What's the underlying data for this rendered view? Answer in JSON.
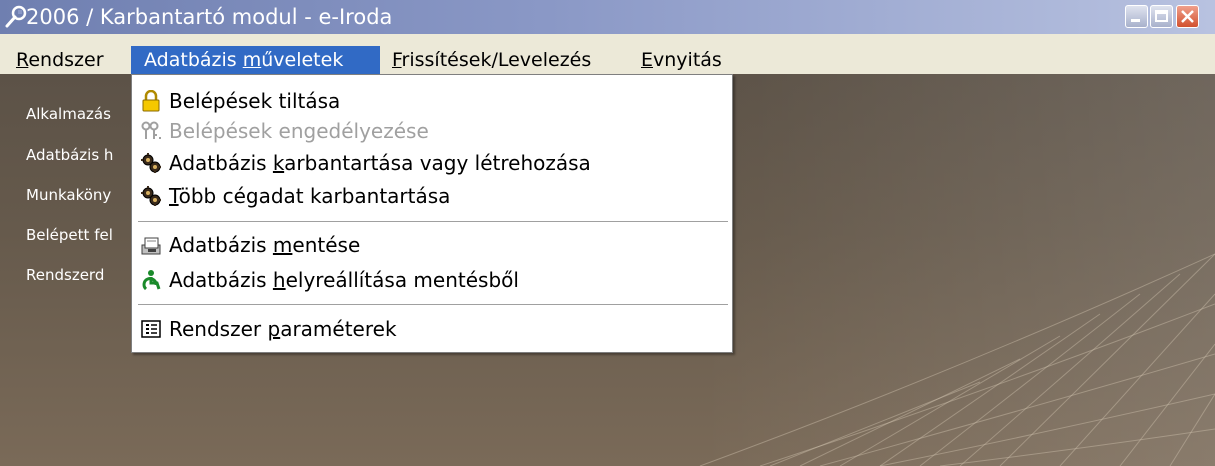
{
  "window": {
    "icon": "wrench-icon",
    "title": "2006 / Karbantartó modul - e-Iroda"
  },
  "menubar": {
    "items": [
      {
        "pre": "",
        "key": "R",
        "post": "endszer"
      },
      {
        "pre": "Adatbázis ",
        "key": "m",
        "post": "űveletek"
      },
      {
        "pre": "",
        "key": "F",
        "post": "rissítések/Levelezés"
      },
      {
        "pre": "",
        "key": "E",
        "post": "vnyitás"
      }
    ]
  },
  "content": {
    "labels": [
      "Alkalmazás",
      "Adatbázis h",
      "Munkaköny",
      "Belépett fel",
      "Rendszerd"
    ]
  },
  "dropdown": {
    "items": [
      {
        "icon": "padlock-icon",
        "pre": "Belépések tiltása",
        "key": "",
        "post": "",
        "disabled": false
      },
      {
        "icon": "keys-icon",
        "pre": "Belépések engedélyezése",
        "key": "",
        "post": "",
        "disabled": true
      },
      {
        "icon": "gears-icon",
        "pre": "Adatbázis ",
        "key": "k",
        "post": "arbantartása vagy létrehozása",
        "disabled": false
      },
      {
        "icon": "gears-icon",
        "pre": "",
        "key": "T",
        "post": "öbb cégadat karbantartása",
        "disabled": false
      },
      {
        "icon": "save-disk-icon",
        "pre": "Adatbázis ",
        "key": "m",
        "post": "entése",
        "disabled": false
      },
      {
        "icon": "restore-icon",
        "pre": "Adatbázis ",
        "key": "h",
        "post": "elyreállítása mentésből",
        "disabled": false
      },
      {
        "icon": "parameters-icon",
        "pre": "Rendszer ",
        "key": "p",
        "post": "araméterek",
        "disabled": false
      }
    ]
  },
  "colors": {
    "titlebar": "#8a98c6",
    "menu_highlight": "#316ac5",
    "background": "#665a4c"
  }
}
